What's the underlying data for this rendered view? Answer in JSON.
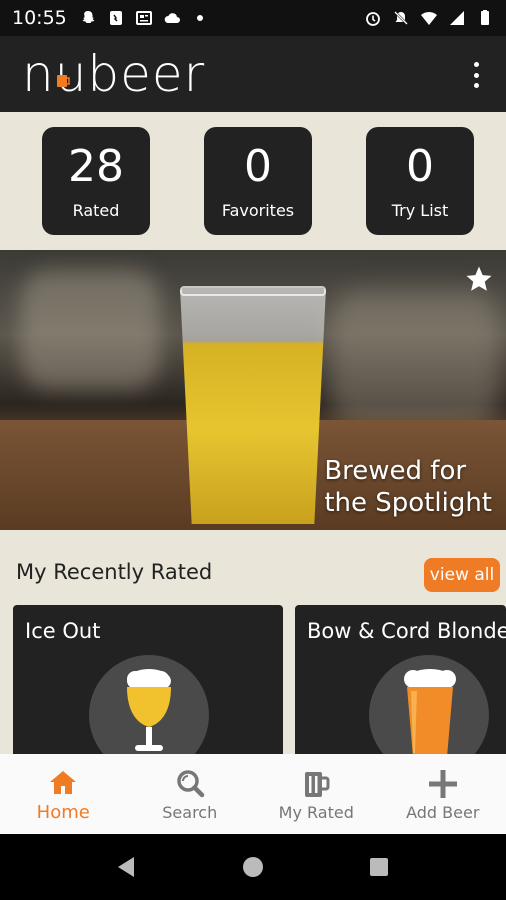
{
  "status_bar": {
    "time": "10:55"
  },
  "app_bar": {
    "logo_text_pre": "n",
    "logo_text_u": "u",
    "logo_text_post": "beer"
  },
  "stats": [
    {
      "value": "28",
      "label": "Rated"
    },
    {
      "value": "0",
      "label": "Favorites"
    },
    {
      "value": "0",
      "label": "Try List"
    }
  ],
  "hero": {
    "caption_line1": "Brewed for",
    "caption_line2": "the Spotlight"
  },
  "recent": {
    "title": "My Recently Rated",
    "view_all_label": "view all",
    "cards": [
      {
        "name": "Ice Out"
      },
      {
        "name": "Bow & Cord Blonde"
      }
    ]
  },
  "bottom_nav": [
    {
      "label": "Home",
      "icon": "home-icon",
      "active": true
    },
    {
      "label": "Search",
      "icon": "search-icon",
      "active": false
    },
    {
      "label": "My Rated",
      "icon": "mug-icon",
      "active": false
    },
    {
      "label": "Add Beer",
      "icon": "plus-icon",
      "active": false
    }
  ],
  "colors": {
    "accent": "#f07b25",
    "dark": "#222222",
    "background": "#e9e5d8"
  }
}
